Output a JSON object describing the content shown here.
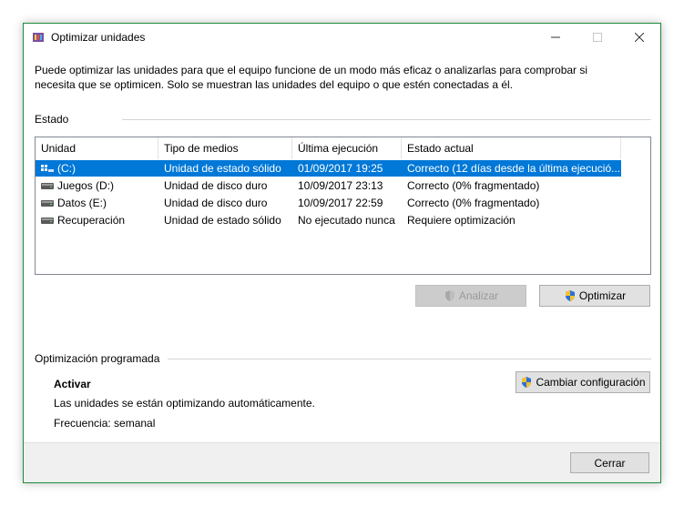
{
  "window": {
    "title": "Optimizar unidades"
  },
  "intro": {
    "line1": "Puede optimizar las unidades para que el equipo funcione de un modo más eficaz o analizarlas para comprobar si",
    "line2": "necesita que se optimicen. Solo se muestran las unidades del equipo o que estén conectadas a él."
  },
  "estado": {
    "label": "Estado",
    "columns": [
      "Unidad",
      "Tipo de medios",
      "Última ejecución",
      "Estado actual"
    ],
    "rows": [
      {
        "name": "(C:)",
        "type": "Unidad de estado sólido",
        "last": "01/09/2017 19:25",
        "status": "Correcto (12 días desde la última ejecució...",
        "icon": "ssd-drive-icon",
        "selected": true
      },
      {
        "name": "Juegos (D:)",
        "type": "Unidad de disco duro",
        "last": "10/09/2017 23:13",
        "status": "Correcto (0% fragmentado)",
        "icon": "hdd-drive-icon"
      },
      {
        "name": "Datos (E:)",
        "type": "Unidad de disco duro",
        "last": "10/09/2017 22:59",
        "status": "Correcto (0% fragmentado)",
        "icon": "hdd-drive-icon"
      },
      {
        "name": "Recuperación",
        "type": "Unidad de estado sólido",
        "last": "No ejecutado nunca",
        "status": "Requiere optimización",
        "icon": "hdd-drive-icon"
      }
    ],
    "analizar_label": "Analizar",
    "optimizar_label": "Optimizar"
  },
  "programada": {
    "label": "Optimización programada",
    "activar": "Activar",
    "desc": "Las unidades se están optimizando automáticamente.",
    "frecuencia": "Frecuencia: semanal",
    "cambiar_label": "Cambiar configuración"
  },
  "footer": {
    "cerrar_label": "Cerrar"
  },
  "colors": {
    "accent": "#0078d7",
    "border": "#1f8a3c"
  }
}
